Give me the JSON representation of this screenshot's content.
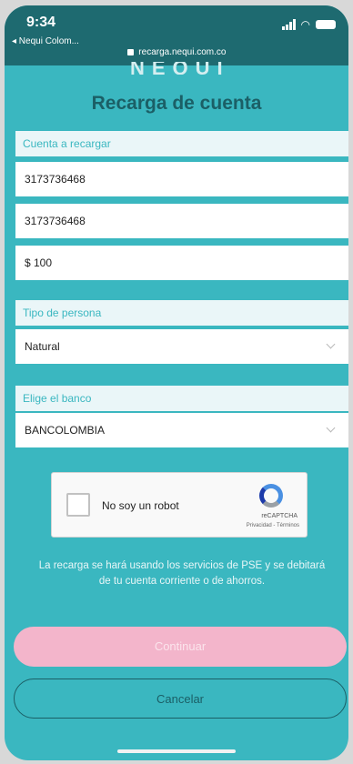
{
  "status_bar": {
    "time": "9:34",
    "back_app": "◂ Nequi Colom...",
    "url": "recarga.nequi.com.co"
  },
  "logo_text": "NEQUI",
  "page_title": "Recarga de cuenta",
  "account_section": {
    "label": "Cuenta a recargar",
    "account_number": "3173736468",
    "account_confirm": "3173736468",
    "amount": "$ 100"
  },
  "person_section": {
    "label": "Tipo de persona",
    "selected": "Natural"
  },
  "bank_section": {
    "label": "Elige el banco",
    "selected": "BANCOLOMBIA"
  },
  "recaptcha": {
    "label": "No soy un robot",
    "brand": "reCAPTCHA",
    "links": "Privacidad - Términos"
  },
  "info_text": "La recarga se hará usando los servicios de PSE y se debitará de tu cuenta corriente o de ahorros.",
  "buttons": {
    "continue": "Continuar",
    "cancel": "Cancelar"
  },
  "colors": {
    "background": "#3ab7c0",
    "title": "#1b5f66",
    "continue_button": "#f3b5cb"
  }
}
